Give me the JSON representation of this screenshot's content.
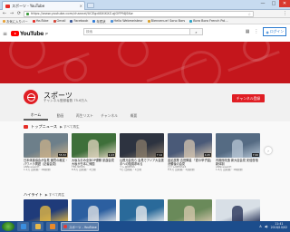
{
  "browser": {
    "tab_title": "スポーツ - YouTube",
    "tab_close": "×",
    "url": "https://www.youtube.com/channel/UCEgdi0XIXXZ-qJOFPf4JSKw",
    "window_controls": [
      "—",
      "□",
      "✕"
    ],
    "nav": [
      "←",
      "→",
      "⟳"
    ],
    "bookmarks": [
      {
        "label": "お気に入りバー",
        "color": "#e8a33a"
      },
      {
        "label": "YouTube",
        "color": "#e52d27"
      },
      {
        "label": "Gmail",
        "color": "#d44638"
      },
      {
        "label": "Facebook",
        "color": "#3b5998"
      },
      {
        "label": "年賀状",
        "color": "#2f7bd6"
      },
      {
        "label": "Hello Webmeisteur",
        "color": "#4a90d9"
      },
      {
        "label": "Bienvenue! Sono Bars",
        "color": "#d9a22e"
      },
      {
        "label": "Bora Bora French Pol...",
        "color": "#2aa4c8"
      }
    ]
  },
  "youtube": {
    "logo_text": "YouTube",
    "logo_suffix": "JP",
    "search_placeholder": "検索",
    "login_label": "ログイン",
    "channel": {
      "title": "スポーツ",
      "subscribers": "チャンネル登録者数 75.6万人",
      "subscribe_label": "チャンネル登録",
      "tabs": [
        "ホーム",
        "動画",
        "再生リスト",
        "チャンネル",
        "概要"
      ]
    },
    "sections": [
      {
        "title": "トップニュース",
        "play_all": "すべて再生",
        "videos": [
          {
            "title": "日本体操協会が会見 厳罰の裁定・パワハラ問題（記者会見）",
            "meta": "ANNnewsCH",
            "meta2": "1.2万 回視聴・1時間前",
            "duration": "55:32",
            "bg": "#6d7f8a",
            "accent": "#c9b08a"
          },
          {
            "title": "大坂なおみ全米OP優勝 凱旋会見 大坂が日本に帰国",
            "meta": "TBS NEWS",
            "meta2": "8.8万 回視聴・2日前",
            "duration": "1:23",
            "bg": "#3e6f3a",
            "accent": "#e3d6c2"
          },
          {
            "title": "山根元会長ら 会見でアジア大会選手への賠償求める",
            "meta": "テレ東NEWS",
            "meta2": "3万 回視聴・1日前",
            "duration": "7:14",
            "bg": "#2d3340",
            "accent": "#8a7c6a"
          },
          {
            "title": "金足農業 吉田輝星 「夏の甲子園」決勝後の会見",
            "meta": "日テレNEWS24",
            "meta2": "9.4万 回視聴・3週間前",
            "duration": "4:45",
            "bg": "#4a5a78",
            "accent": "#d5c6b0"
          },
          {
            "title": "内閣府改造 新大臣会見 安倍首相新体制",
            "meta": "ANNnewsCH",
            "meta2": "1.6万 回視聴・1時間前",
            "duration": "7:06",
            "bg": "#556b83",
            "accent": "#b8c7d5"
          }
        ]
      },
      {
        "title": "ハイライト",
        "play_all": "すべて再生",
        "videos": [
          {
            "title": "",
            "meta": "",
            "meta2": "",
            "duration": "",
            "bg": "#1f3b7a",
            "accent": "#f0c040"
          },
          {
            "title": "",
            "meta": "",
            "meta2": "",
            "duration": "",
            "bg": "#2c5fa0",
            "accent": "#e8e8e8"
          },
          {
            "title": "",
            "meta": "",
            "meta2": "",
            "duration": "",
            "bg": "#2a6a9a",
            "accent": "#f2f2f2"
          },
          {
            "title": "",
            "meta": "",
            "meta2": "",
            "duration": "",
            "bg": "#6a8a5a",
            "accent": "#d9c9b0"
          },
          {
            "title": "",
            "meta": "",
            "meta2": "",
            "duration": "",
            "bg": "#d8dfe6",
            "accent": "#1e2a50"
          }
        ]
      }
    ]
  },
  "taskbar": {
    "active_window": "スポーツ - YouTube",
    "ime": "A",
    "time": "11:41",
    "date": "2018/10/02"
  },
  "colors": {
    "brand_red": "#e01e24",
    "banner_red": "#c4161c",
    "taskbar": "#1c4d8c"
  }
}
